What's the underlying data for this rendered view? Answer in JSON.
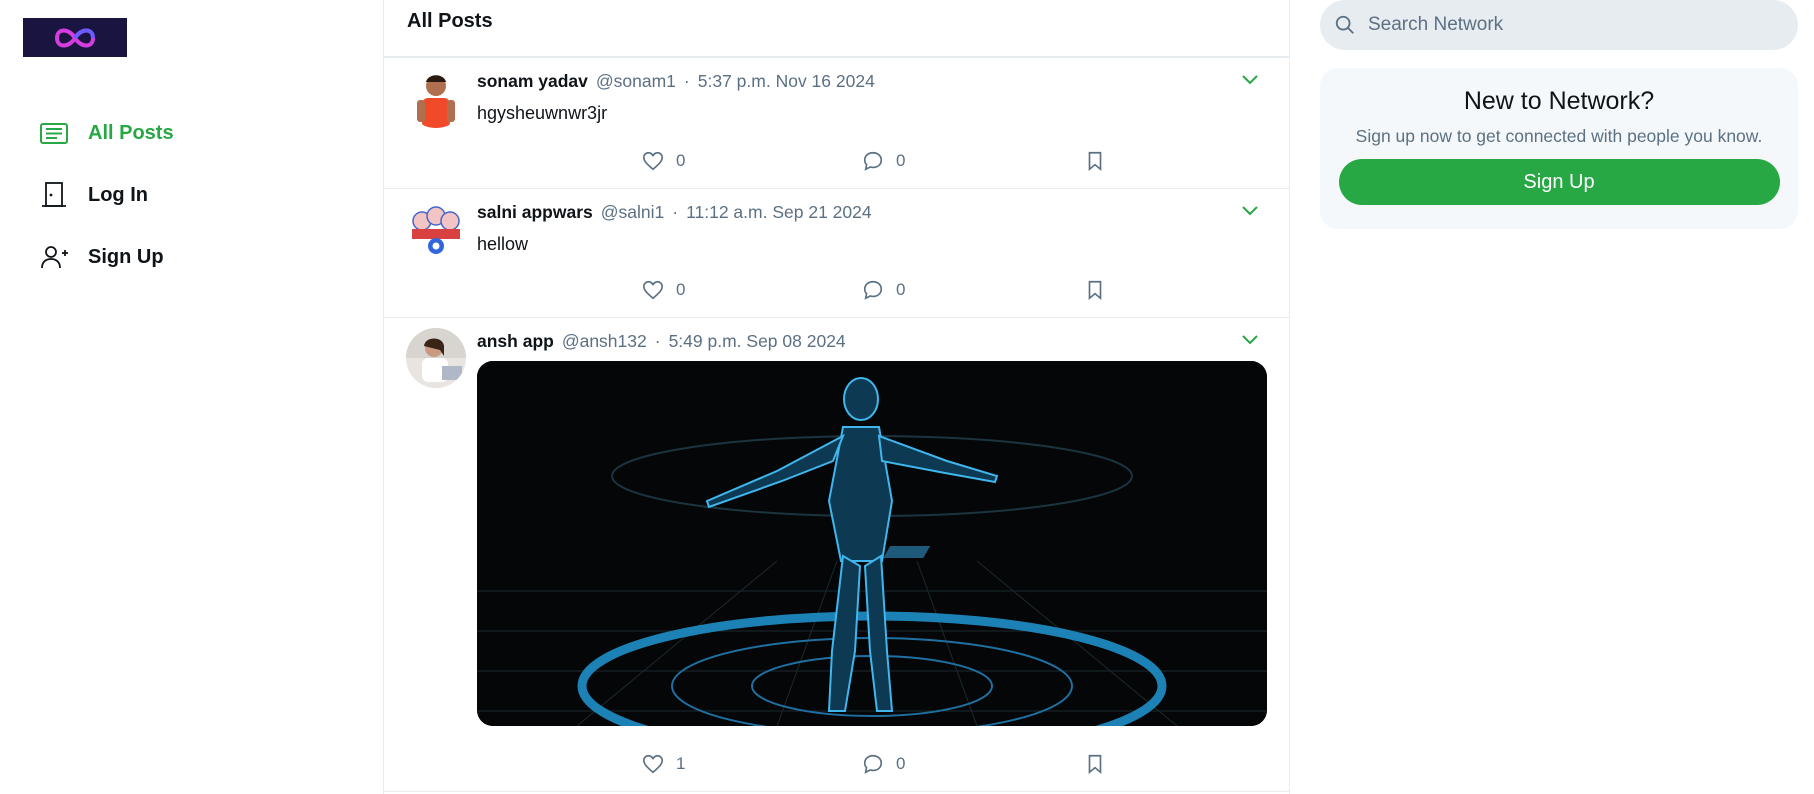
{
  "colors": {
    "accent": "#28a745",
    "muted": "#5b7083",
    "border": "#e6ecf0"
  },
  "sidebar": {
    "logo_icon": "infinity-logo",
    "items": [
      {
        "label": "All Posts",
        "icon": "feed-icon",
        "active": true
      },
      {
        "label": "Log In",
        "icon": "door-icon",
        "active": false
      },
      {
        "label": "Sign Up",
        "icon": "user-plus-icon",
        "active": false
      }
    ]
  },
  "feed": {
    "title": "All Posts",
    "posts": [
      {
        "name": "sonam yadav",
        "handle": "@sonam1",
        "dot": "·",
        "time": "5:37 p.m. Nov 16 2024",
        "text": "hgysheuwnwr3jr",
        "likes": "0",
        "comments": "0",
        "has_image": false
      },
      {
        "name": "salni appwars",
        "handle": "@salni1",
        "dot": "·",
        "time": "11:12 a.m. Sep 21 2024",
        "text": "hellow",
        "likes": "0",
        "comments": "0",
        "has_image": false
      },
      {
        "name": "ansh app",
        "handle": "@ansh132",
        "dot": "·",
        "time": "5:49 p.m. Sep 08 2024",
        "text": "",
        "likes": "1",
        "comments": "0",
        "has_image": true
      }
    ]
  },
  "search": {
    "placeholder": "Search Network"
  },
  "signup_card": {
    "title": "New to Network?",
    "subtitle": "Sign up now to get connected with people you know.",
    "button_label": "Sign Up"
  }
}
